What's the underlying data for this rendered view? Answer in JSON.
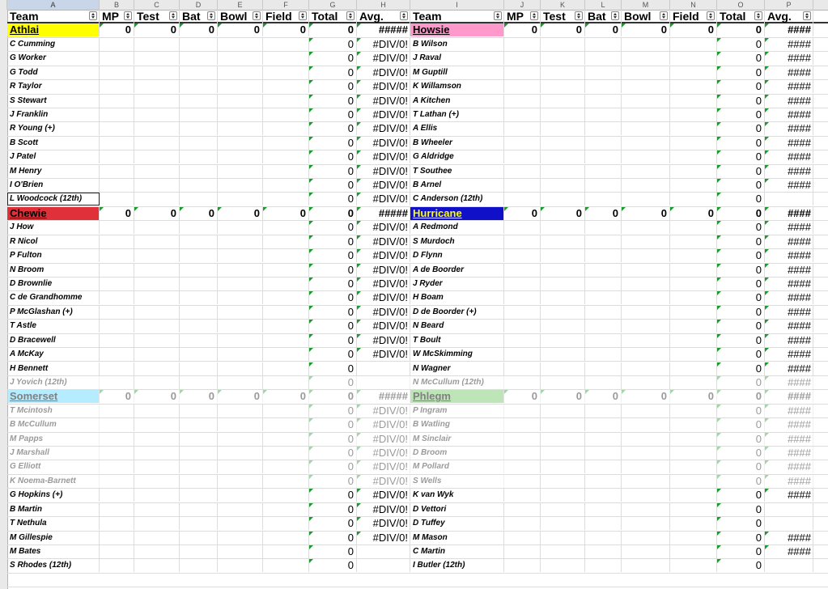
{
  "columns": [
    "A",
    "B",
    "C",
    "D",
    "E",
    "F",
    "G",
    "H",
    "I",
    "J",
    "K",
    "L",
    "M",
    "N",
    "O",
    "P"
  ],
  "header_labels": [
    "Team",
    "MP",
    "Test",
    "Bat",
    "Bowl",
    "Field",
    "Total",
    "Avg.",
    "Team",
    "MP",
    "Test",
    "Bat",
    "Bowl",
    "Field",
    "Total",
    "Avg."
  ],
  "left_blocks": [
    {
      "team": "Athlai",
      "color": "#ffff00",
      "text": "#000000",
      "avg": "#####",
      "players": [
        {
          "name": "C Cumming",
          "total": "0",
          "avg": "#DIV/0!"
        },
        {
          "name": "G Worker",
          "total": "0",
          "avg": "#DIV/0!"
        },
        {
          "name": "G Todd",
          "total": "0",
          "avg": "#DIV/0!"
        },
        {
          "name": "R Taylor",
          "total": "0",
          "avg": "#DIV/0!"
        },
        {
          "name": "S Stewart",
          "total": "0",
          "avg": "#DIV/0!"
        },
        {
          "name": "J Franklin",
          "total": "0",
          "avg": "#DIV/0!"
        },
        {
          "name": "R Young (+)",
          "total": "0",
          "avg": "#DIV/0!"
        },
        {
          "name": "B Scott",
          "total": "0",
          "avg": "#DIV/0!"
        },
        {
          "name": "J Patel",
          "total": "0",
          "avg": "#DIV/0!"
        },
        {
          "name": "M Henry",
          "total": "0",
          "avg": "#DIV/0!"
        },
        {
          "name": "I O'Brien",
          "total": "0",
          "avg": "#DIV/0!"
        },
        {
          "name": "L Woodcock (12th)",
          "total": "0",
          "avg": "#DIV/0!"
        }
      ]
    },
    {
      "team": "Chewie",
      "color": "#e0303a",
      "text": "#000000",
      "avg": "#####",
      "players": [
        {
          "name": "J How",
          "total": "0",
          "avg": "#DIV/0!"
        },
        {
          "name": "R Nicol",
          "total": "0",
          "avg": "#DIV/0!"
        },
        {
          "name": "P Fulton",
          "total": "0",
          "avg": "#DIV/0!"
        },
        {
          "name": "N Broom",
          "total": "0",
          "avg": "#DIV/0!"
        },
        {
          "name": "D Brownlie",
          "total": "0",
          "avg": "#DIV/0!"
        },
        {
          "name": "C de Grandhomme",
          "total": "0",
          "avg": "#DIV/0!"
        },
        {
          "name": "P McGlashan (+)",
          "total": "0",
          "avg": "#DIV/0!"
        },
        {
          "name": "T Astle",
          "total": "0",
          "avg": "#DIV/0!"
        },
        {
          "name": "D Bracewell",
          "total": "0",
          "avg": "#DIV/0!"
        },
        {
          "name": "A McKay",
          "total": "0",
          "avg": "#DIV/0!"
        },
        {
          "name": "H Bennett",
          "total": "0",
          "avg": ""
        },
        {
          "name": "J Yovich (12th)",
          "total": "0",
          "avg": ""
        }
      ]
    },
    {
      "team": "Somerset",
      "color": "#9ee6ff",
      "text": "#555555",
      "avg": "#####",
      "players": [
        {
          "name": "T Mcintosh",
          "total": "0",
          "avg": "#DIV/0!"
        },
        {
          "name": "B McCullum",
          "total": "0",
          "avg": "#DIV/0!"
        },
        {
          "name": "M Papps",
          "total": "0",
          "avg": "#DIV/0!"
        },
        {
          "name": "J Marshall",
          "total": "0",
          "avg": "#DIV/0!"
        },
        {
          "name": "G Elliott",
          "total": "0",
          "avg": "#DIV/0!"
        },
        {
          "name": "K Noema-Barnett",
          "total": "0",
          "avg": "#DIV/0!"
        },
        {
          "name": "G Hopkins (+)",
          "total": "0",
          "avg": "#DIV/0!"
        },
        {
          "name": "B Martin",
          "total": "0",
          "avg": "#DIV/0!"
        },
        {
          "name": "T Nethula",
          "total": "0",
          "avg": "#DIV/0!"
        },
        {
          "name": "M Gillespie",
          "total": "0",
          "avg": "#DIV/0!"
        },
        {
          "name": "M Bates",
          "total": "0",
          "avg": ""
        },
        {
          "name": "S Rhodes (12th)",
          "total": "0",
          "avg": ""
        }
      ]
    }
  ],
  "right_blocks": [
    {
      "team": "Howsie",
      "color": "#ff99cc",
      "text": "#000000",
      "avg": "####",
      "players": [
        {
          "name": "B Wilson",
          "total": "0",
          "avg": "####"
        },
        {
          "name": "J Raval",
          "total": "0",
          "avg": "####"
        },
        {
          "name": "M Guptill",
          "total": "0",
          "avg": "####"
        },
        {
          "name": "K Willamson",
          "total": "0",
          "avg": "####"
        },
        {
          "name": "A Kitchen",
          "total": "0",
          "avg": "####"
        },
        {
          "name": "T Lathan (+)",
          "total": "0",
          "avg": "####"
        },
        {
          "name": "A Ellis",
          "total": "0",
          "avg": "####"
        },
        {
          "name": "B Wheeler",
          "total": "0",
          "avg": "####"
        },
        {
          "name": "G Aldridge",
          "total": "0",
          "avg": "####"
        },
        {
          "name": "T Southee",
          "total": "0",
          "avg": "####"
        },
        {
          "name": "B Arnel",
          "total": "0",
          "avg": "####"
        },
        {
          "name": "C Anderson (12th)",
          "total": "0",
          "avg": ""
        }
      ]
    },
    {
      "team": "Hurricane",
      "color": "#1010c8",
      "text": "#ffff00",
      "avg": "####",
      "players": [
        {
          "name": "A Redmond",
          "total": "0",
          "avg": "####"
        },
        {
          "name": "S Murdoch",
          "total": "0",
          "avg": "####"
        },
        {
          "name": "D Flynn",
          "total": "0",
          "avg": "####"
        },
        {
          "name": "A de Boorder",
          "total": "0",
          "avg": "####"
        },
        {
          "name": "J Ryder",
          "total": "0",
          "avg": "####"
        },
        {
          "name": "H Boam",
          "total": "0",
          "avg": "####"
        },
        {
          "name": "D de Boorder (+)",
          "total": "0",
          "avg": "####"
        },
        {
          "name": "N Beard",
          "total": "0",
          "avg": "####"
        },
        {
          "name": "T Boult",
          "total": "0",
          "avg": "####"
        },
        {
          "name": "W McSkimming",
          "total": "0",
          "avg": "####"
        },
        {
          "name": "N Wagner",
          "total": "0",
          "avg": "####"
        },
        {
          "name": "N McCullum (12th)",
          "total": "0",
          "avg": "####"
        }
      ]
    },
    {
      "team": "Phlegm",
      "color": "#a8dca0",
      "text": "#555555",
      "avg": "####",
      "players": [
        {
          "name": "P Ingram",
          "total": "0",
          "avg": "####"
        },
        {
          "name": "B Watling",
          "total": "0",
          "avg": "####"
        },
        {
          "name": "M Sinclair",
          "total": "0",
          "avg": "####"
        },
        {
          "name": "D Broom",
          "total": "0",
          "avg": "####"
        },
        {
          "name": "M Pollard",
          "total": "0",
          "avg": "####"
        },
        {
          "name": "S Wells",
          "total": "0",
          "avg": "####"
        },
        {
          "name": "K van Wyk",
          "total": "0",
          "avg": "####"
        },
        {
          "name": "D Vettori",
          "total": "0",
          "avg": ""
        },
        {
          "name": "D Tuffey",
          "total": "0",
          "avg": ""
        },
        {
          "name": "M Mason",
          "total": "0",
          "avg": "####"
        },
        {
          "name": "C Martin",
          "total": "0",
          "avg": "####"
        },
        {
          "name": "I Butler (12th)",
          "total": "0",
          "avg": ""
        }
      ]
    }
  ],
  "team_zero": "0",
  "faded_blocks": [
    "Somerset",
    "Phlegm"
  ]
}
